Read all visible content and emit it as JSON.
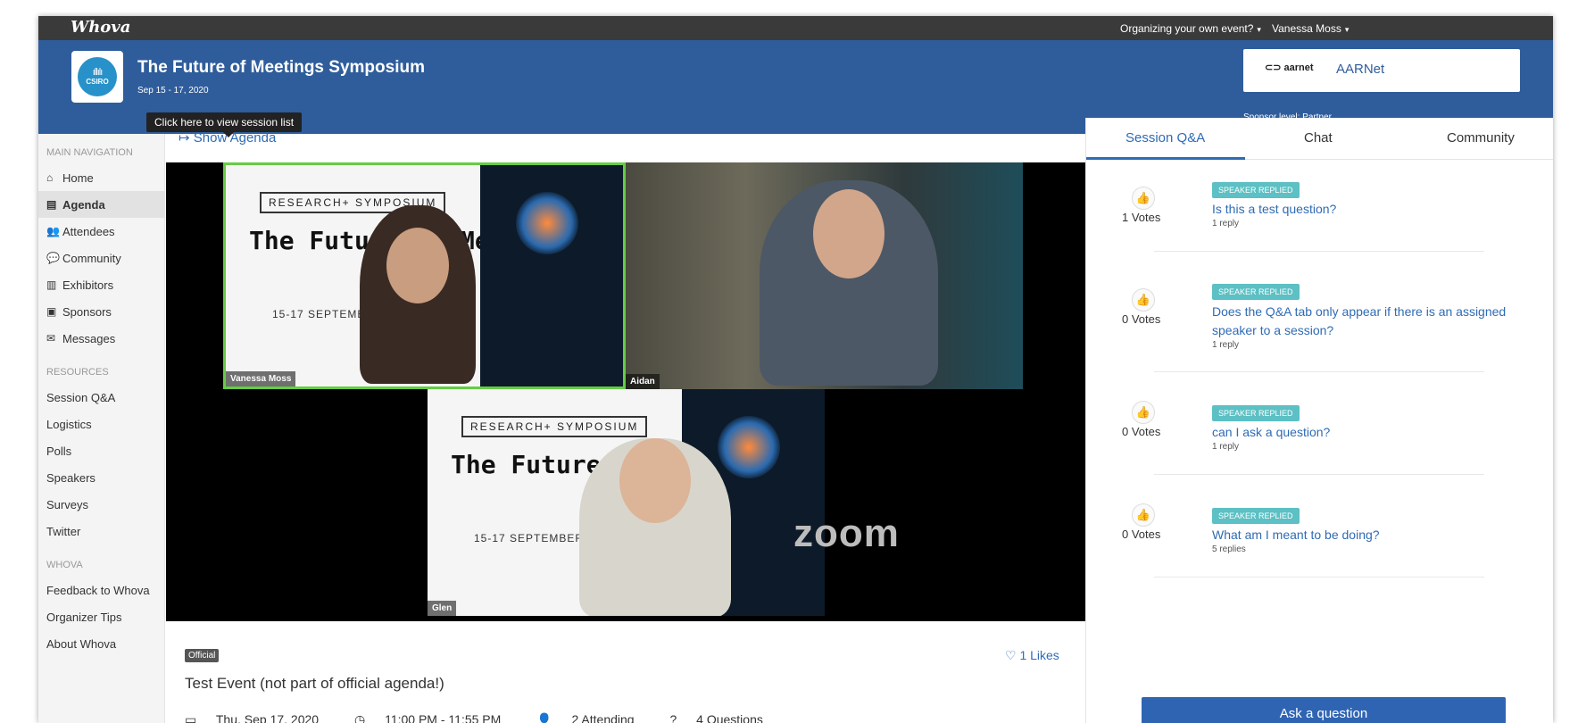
{
  "topbar": {
    "logo": "Whova",
    "organizing_menu": "Organizing your own event?",
    "user_menu": "Vanessa Moss"
  },
  "header": {
    "event_logo_text": "CSIRO",
    "event_title": "The Future of Meetings Symposium",
    "event_dates": "Sep 15 - 17, 2020",
    "tooltip": "Click here to view session list",
    "sponsor_logo": "aarnet",
    "sponsor_name": "AARNet",
    "sponsor_level": "Sponsor level: Partner"
  },
  "sidebar": {
    "main_nav_heading": "MAIN NAVIGATION",
    "main_items": [
      {
        "label": "Home",
        "icon": "home-icon"
      },
      {
        "label": "Agenda",
        "icon": "calendar-icon",
        "active": true
      },
      {
        "label": "Attendees",
        "icon": "people-icon"
      },
      {
        "label": "Community",
        "icon": "chat-bubbles-icon"
      },
      {
        "label": "Exhibitors",
        "icon": "building-icon"
      },
      {
        "label": "Sponsors",
        "icon": "badge-icon"
      },
      {
        "label": "Messages",
        "icon": "envelope-icon"
      }
    ],
    "resources_heading": "RESOURCES",
    "resource_items": [
      "Session Q&A",
      "Logistics",
      "Polls",
      "Speakers",
      "Surveys",
      "Twitter"
    ],
    "whova_heading": "WHOVA",
    "whova_items": [
      "Feedback to Whova",
      "Organizer Tips",
      "About Whova"
    ]
  },
  "main": {
    "show_agenda": "Show Agenda",
    "video": {
      "participants": [
        "Vanessa Moss",
        "Aidan",
        "Glen"
      ],
      "slide_tag": "RESEARCH+ SYMPOSIUM",
      "slide_title": "The Future of Meetings",
      "slide_date": "15-17 SEPTEMBER 2020",
      "zoom_logo": "zoom"
    },
    "official_badge": "Official",
    "likes": "1 Likes",
    "session_title": "Test Event (not part of official agenda!)",
    "meta": {
      "date": "Thu, Sep 17, 2020",
      "time": "11:00 PM - 11:55 PM",
      "attending": "2 Attending",
      "questions": "4 Questions"
    }
  },
  "right_panel": {
    "tabs": [
      "Session Q&A",
      "Chat",
      "Community"
    ],
    "active_tab": "Session Q&A",
    "questions": [
      {
        "votes": "1 Votes",
        "badge": "SPEAKER REPLIED",
        "text": "Is this a test question?",
        "replies": "1 reply"
      },
      {
        "votes": "0 Votes",
        "badge": "SPEAKER REPLIED",
        "text": "Does the Q&A tab only appear if there is an assigned speaker to a session?",
        "replies": "1 reply"
      },
      {
        "votes": "0 Votes",
        "badge": "SPEAKER REPLIED",
        "text": "can I ask a question?",
        "replies": "1 reply"
      },
      {
        "votes": "0 Votes",
        "badge": "SPEAKER REPLIED",
        "text": "What am I meant to be doing?",
        "replies": "5 replies"
      }
    ],
    "ask_button": "Ask a question"
  },
  "colors": {
    "header_blue": "#2f5d9b",
    "link_blue": "#2f6bb5",
    "badge_teal": "#5cc0c4",
    "active_speaker_green": "#66cc44"
  }
}
